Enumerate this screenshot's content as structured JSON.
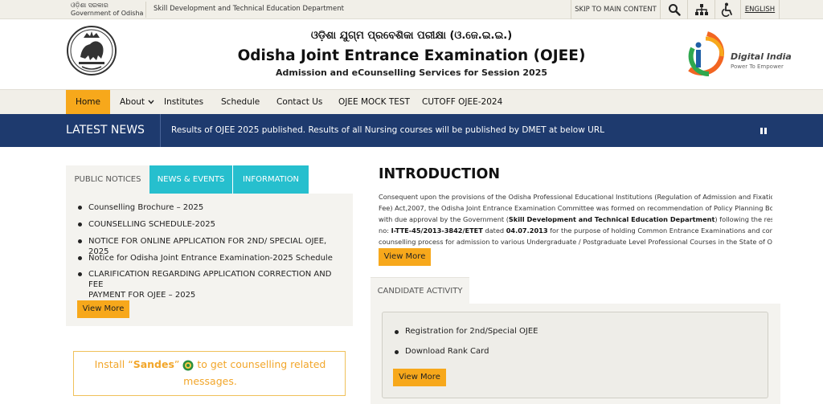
{
  "topbar": {
    "gov_odia": "ଓଡ଼ିଶା ସରକାର",
    "gov_english": "Government of Odisha",
    "department": "Skill Development and Technical Education Department",
    "skip_label": "SKIP TO MAIN CONTENT",
    "language_label": "ENGLISH",
    "icons": [
      "search-icon",
      "sitemap-icon",
      "accessibility-icon"
    ]
  },
  "header": {
    "odia_title": "ଓଡ଼ିଶା ଯୁଗ୍ମ ପ୍ରବେଶିକା ପରୀକ୍ଷା (ଓ.ଜେ.ଇ.ଇ.)",
    "title": "Odisha Joint Entrance Examination (OJEE)",
    "subtitle": "Admission and eCounselling Services for Session 2025",
    "emblem_text": "ଓଡ଼ିଶା ସରକାର",
    "digital_india_title": "Digital India",
    "digital_india_tagline": "Power To Empower"
  },
  "nav": {
    "items": [
      "Home",
      "About",
      "Institutes",
      "Schedule",
      "Contact Us",
      "OJEE MOCK TEST",
      "CUTOFF OJEE-2024"
    ],
    "active": "Home"
  },
  "latest_news": {
    "label": "LATEST NEWS",
    "text": "Results of OJEE 2025 published. Results of all Nursing courses will be published by DMET at below URL"
  },
  "notices": {
    "tabs": [
      "PUBLIC NOTICES",
      "NEWS & EVENTS",
      "INFORMATION"
    ],
    "items": [
      "Counselling Brochure – 2025",
      "COUNSELLING SCHEDULE-2025",
      "NOTICE FOR ONLINE APPLICATION FOR 2ND/ SPECIAL OJEE, 2025",
      "Notice for Odisha Joint Entrance Examination-2025 Schedule",
      "CLARIFICATION REGARDING APPLICATION CORRECTION AND FEE",
      "PAYMENT FOR OJEE – 2025"
    ],
    "view_more": "View More"
  },
  "sandes": {
    "line1_before": "Install “",
    "app_name": "Sandes",
    "line1_after": "” ",
    "line1_end": " to get counselling related",
    "line2": "messages."
  },
  "intro": {
    "title": "INTRODUCTION",
    "line1": "Consequent upon the provisions of the Odisha Professional Educational Institutions (Regulation of Admission and Fixation of",
    "line2": "Fee) Act,2007, the Odisha Joint Entrance Examination Committee was formed on recommendation of Policy Planning Body",
    "line3a": "with due approval by the Government (",
    "line3b": "Skill Development and Technical Education Department",
    "line3c": ") following the resolution",
    "line4a": "no: ",
    "line4b": "I-TTE-45/2013-3842/ETET",
    "line4c": " dated ",
    "line4d": "04.07.2013",
    "line4e": " for the purpose of holding Common Entrance Examinations and conducting",
    "line5": "counselling process for admission to various Undergraduate / Postgraduate Level Professional Courses in the State of Odisha.",
    "view_more": "View More"
  },
  "candidate_activity": {
    "tab": "CANDIDATE ACTIVITY",
    "items": [
      "Registration for 2nd/Special OJEE",
      "Download Rank Card"
    ],
    "view_more": "View More"
  },
  "colors": {
    "accent": "#f7a81b",
    "news_bar": "#1e3a6e",
    "tab_teal": "#26bfce",
    "panel": "#f4f3ef"
  }
}
